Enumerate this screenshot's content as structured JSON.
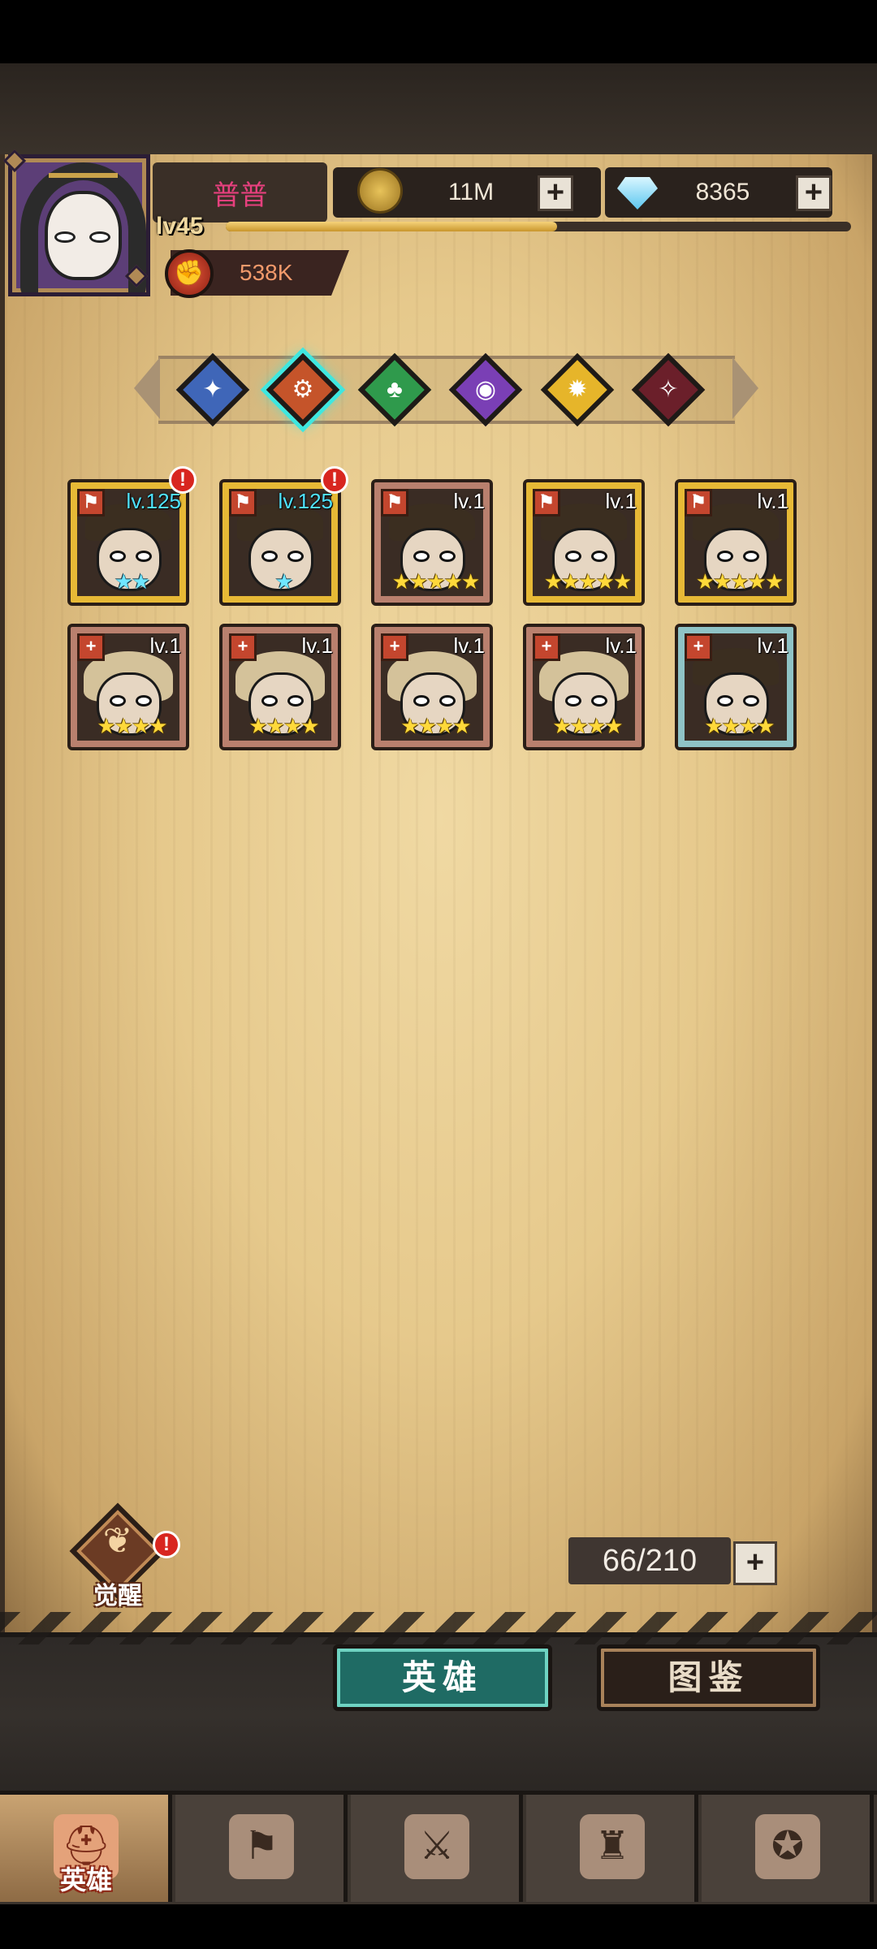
{
  "player": {
    "name": "普普",
    "level": "lv45",
    "xp_fraction": 0.53,
    "power": "538K"
  },
  "resources": {
    "gold": "11M",
    "gems": "8365"
  },
  "factions": [
    {
      "name": "water",
      "color": "#3f66b8",
      "glyph": "✦"
    },
    {
      "name": "fire",
      "color": "#c5542a",
      "glyph": "⚙",
      "selected": true
    },
    {
      "name": "nature",
      "color": "#2f9a4c",
      "glyph": "♣"
    },
    {
      "name": "shadow",
      "color": "#7a3fb5",
      "glyph": "◉"
    },
    {
      "name": "light",
      "color": "#e6b52a",
      "glyph": "✹"
    },
    {
      "name": "dark",
      "color": "#6b1f2a",
      "glyph": "✧"
    }
  ],
  "heroes": [
    {
      "level": "lv.125",
      "stars": "★★",
      "frame": "gold",
      "star_color": "cyan",
      "alert": "!"
    },
    {
      "level": "lv.125",
      "stars": "★",
      "frame": "gold",
      "star_color": "cyan",
      "alert": "!"
    },
    {
      "level": "lv.1",
      "stars": "★★★★★",
      "frame": "red",
      "star_color": "gold"
    },
    {
      "level": "lv.1",
      "stars": "★★★★★",
      "frame": "gold",
      "star_color": "gold"
    },
    {
      "level": "lv.1",
      "stars": "★★★★★",
      "frame": "gold",
      "star_color": "gold"
    },
    {
      "level": "lv.1",
      "stars": "★★★★",
      "frame": "red",
      "star_color": "gold"
    },
    {
      "level": "lv.1",
      "stars": "★★★★",
      "frame": "red",
      "star_color": "gold"
    },
    {
      "level": "lv.1",
      "stars": "★★★★",
      "frame": "red",
      "star_color": "gold"
    },
    {
      "level": "lv.1",
      "stars": "★★★★",
      "frame": "red",
      "star_color": "gold"
    },
    {
      "level": "lv.1",
      "stars": "★★★★",
      "frame": "cyan",
      "star_color": "gold"
    }
  ],
  "awaken": {
    "label": "觉醒",
    "alert": "!"
  },
  "capacity": {
    "text": "66/210"
  },
  "tabs": {
    "hero": "英雄",
    "codex": "图鉴"
  },
  "nav": [
    {
      "icon": "helmet-icon",
      "label": "英雄",
      "active": true
    },
    {
      "icon": "banner-icon",
      "label": ""
    },
    {
      "icon": "crossed-swords-icon",
      "label": ""
    },
    {
      "icon": "castle-icon",
      "label": ""
    },
    {
      "icon": "guild-handshake-icon",
      "label": ""
    }
  ]
}
